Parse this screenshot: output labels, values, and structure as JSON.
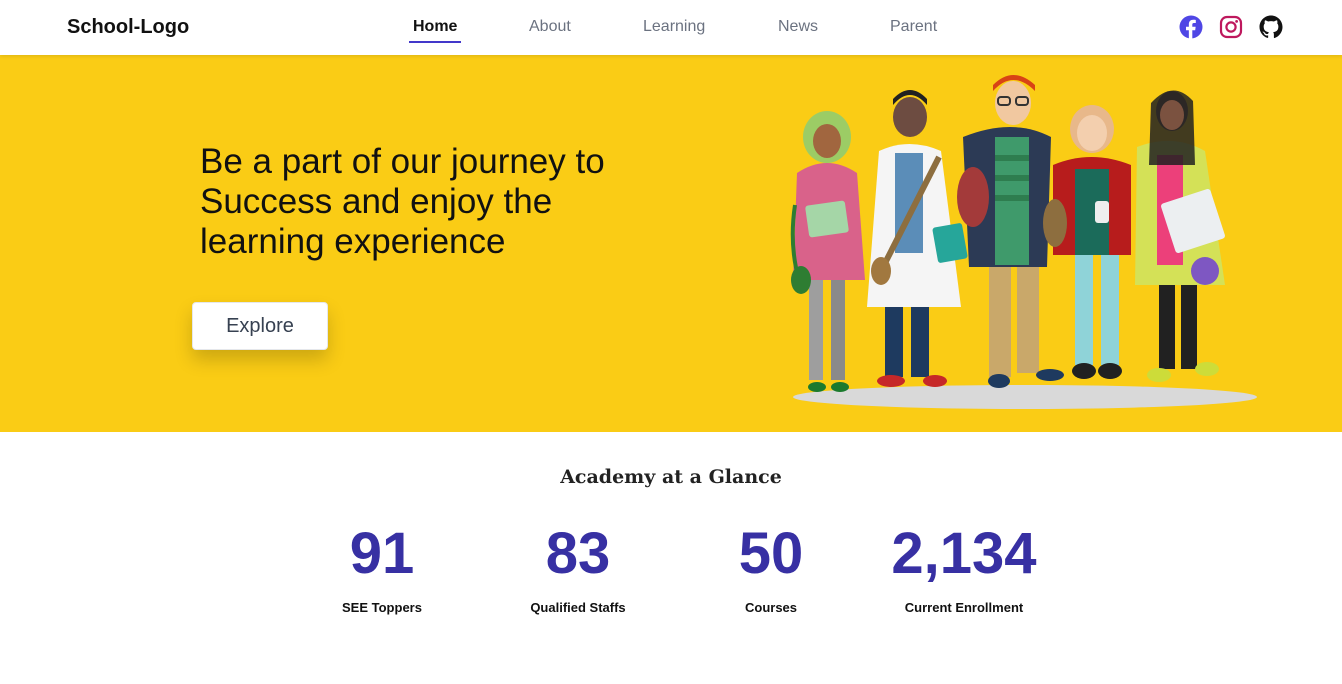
{
  "navbar": {
    "logo": "School-Logo",
    "links": [
      {
        "label": "Home",
        "active": true
      },
      {
        "label": "About",
        "active": false
      },
      {
        "label": "Learning",
        "active": false
      },
      {
        "label": "News",
        "active": false
      },
      {
        "label": "Parent",
        "active": false
      }
    ],
    "social": [
      {
        "icon": "facebook-icon",
        "color": "#4f46e5"
      },
      {
        "icon": "instagram-icon",
        "color": "#be185d"
      },
      {
        "icon": "github-icon",
        "color": "#111111"
      }
    ]
  },
  "hero": {
    "headline": "Be a part of our journey to Success and enjoy the learning experience",
    "cta_label": "Explore",
    "background": "#facc15"
  },
  "glance": {
    "title": "Academy at a Glance",
    "stats": [
      {
        "value": "91",
        "label": "SEE Toppers"
      },
      {
        "value": "83",
        "label": "Qualified Staffs"
      },
      {
        "value": "50",
        "label": "Courses"
      },
      {
        "value": "2,134",
        "label": "Current Enrollment"
      }
    ],
    "accent": "#3730a3"
  }
}
